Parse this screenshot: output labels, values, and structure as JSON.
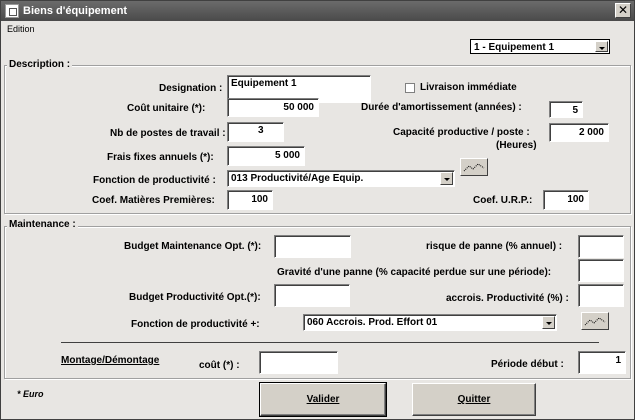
{
  "window": {
    "title": "Biens d'équipement"
  },
  "menu": {
    "edition": "Edition"
  },
  "selector": {
    "value": "1 - Equipement 1"
  },
  "description": {
    "section_label": "Description :",
    "designation": {
      "label": "Designation :",
      "value": "Equipement 1"
    },
    "livraison": {
      "label": "Livraison immédiate",
      "checked": false
    },
    "cout_unitaire": {
      "label": "Coût unitaire (*):",
      "value": "50 000"
    },
    "duree": {
      "label": "Durée d'amortissement (années) :",
      "value": "5"
    },
    "nb_postes": {
      "label": "Nb de postes de travail :",
      "value": "3"
    },
    "capacite": {
      "label_line1": "Capacité productive / poste :",
      "label_line2": "(Heures)",
      "value": "2 000"
    },
    "frais_fixes": {
      "label": "Frais fixes annuels (*):",
      "value": "5 000"
    },
    "fonction_prod": {
      "label": "Fonction de productivité :",
      "value": "013 Productivité/Age Equip."
    },
    "coef_mp": {
      "label": "Coef. Matières Premières:",
      "value": "100"
    },
    "coef_urp": {
      "label": "Coef. U.R.P.:",
      "value": "100"
    }
  },
  "maintenance": {
    "section_label": "Maintenance :",
    "budget_maint": {
      "label": "Budget Maintenance Opt. (*):",
      "value": ""
    },
    "risque_panne": {
      "label": "risque de panne (% annuel) :",
      "value": ""
    },
    "gravite": {
      "label": "Gravité d'une panne (% capacité perdue sur une période):",
      "value": ""
    },
    "budget_prod": {
      "label": "Budget Productivité Opt.(*):",
      "value": ""
    },
    "accrois": {
      "label": "accrois. Productivité (%) :",
      "value": ""
    },
    "fonction_prod_plus": {
      "label": "Fonction de productivité +:",
      "value": "060 Accrois. Prod. Effort 01"
    },
    "montage": {
      "label": "Montage/Démontage"
    },
    "cout": {
      "label": "coût (*) :",
      "value": ""
    },
    "periode_debut": {
      "label": "Période début :",
      "value": "1"
    }
  },
  "footer": {
    "note": "* Euro",
    "valider": "Valider",
    "quitter": "Quitter"
  }
}
